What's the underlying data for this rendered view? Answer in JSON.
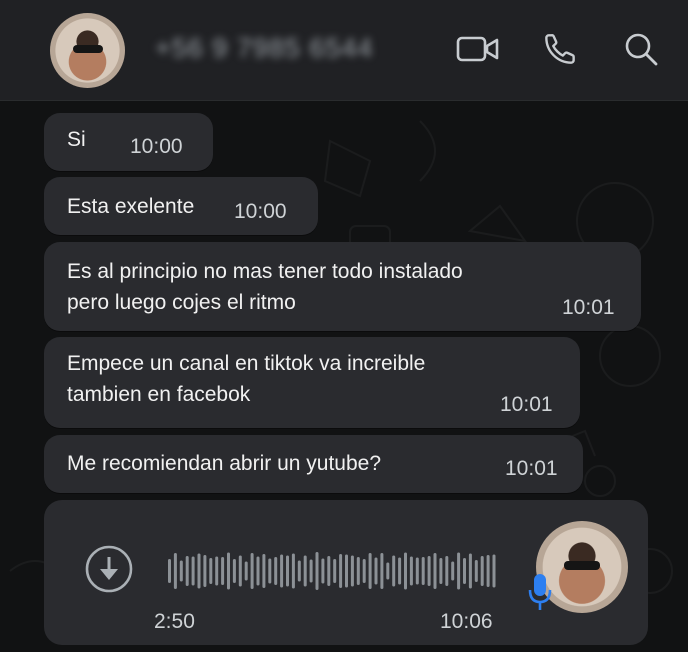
{
  "header": {
    "phone_number": "+56 9 7985 6544",
    "icons": [
      "video-call-icon",
      "phone-call-icon",
      "search-icon"
    ]
  },
  "messages": [
    {
      "text": "Si",
      "time": "10:00"
    },
    {
      "text": "Esta exelente",
      "time": "10:00"
    },
    {
      "text": "Es al principio no mas tener todo instalado\npero luego cojes el ritmo",
      "time": "10:01"
    },
    {
      "text": "Empece un canal en tiktok va increible\ntambien en facebok",
      "time": "10:01"
    },
    {
      "text": "Me recomiendan abrir un yutube?",
      "time": "10:01"
    }
  ],
  "voice_message": {
    "duration": "2:50",
    "time": "10:06",
    "icons": [
      "download-icon",
      "microphone-icon"
    ]
  },
  "colors": {
    "header_bg": "#202124",
    "bubble_bg": "#2a2b2f",
    "chat_bg": "#111213",
    "mic_accent": "#2d7ff0"
  }
}
